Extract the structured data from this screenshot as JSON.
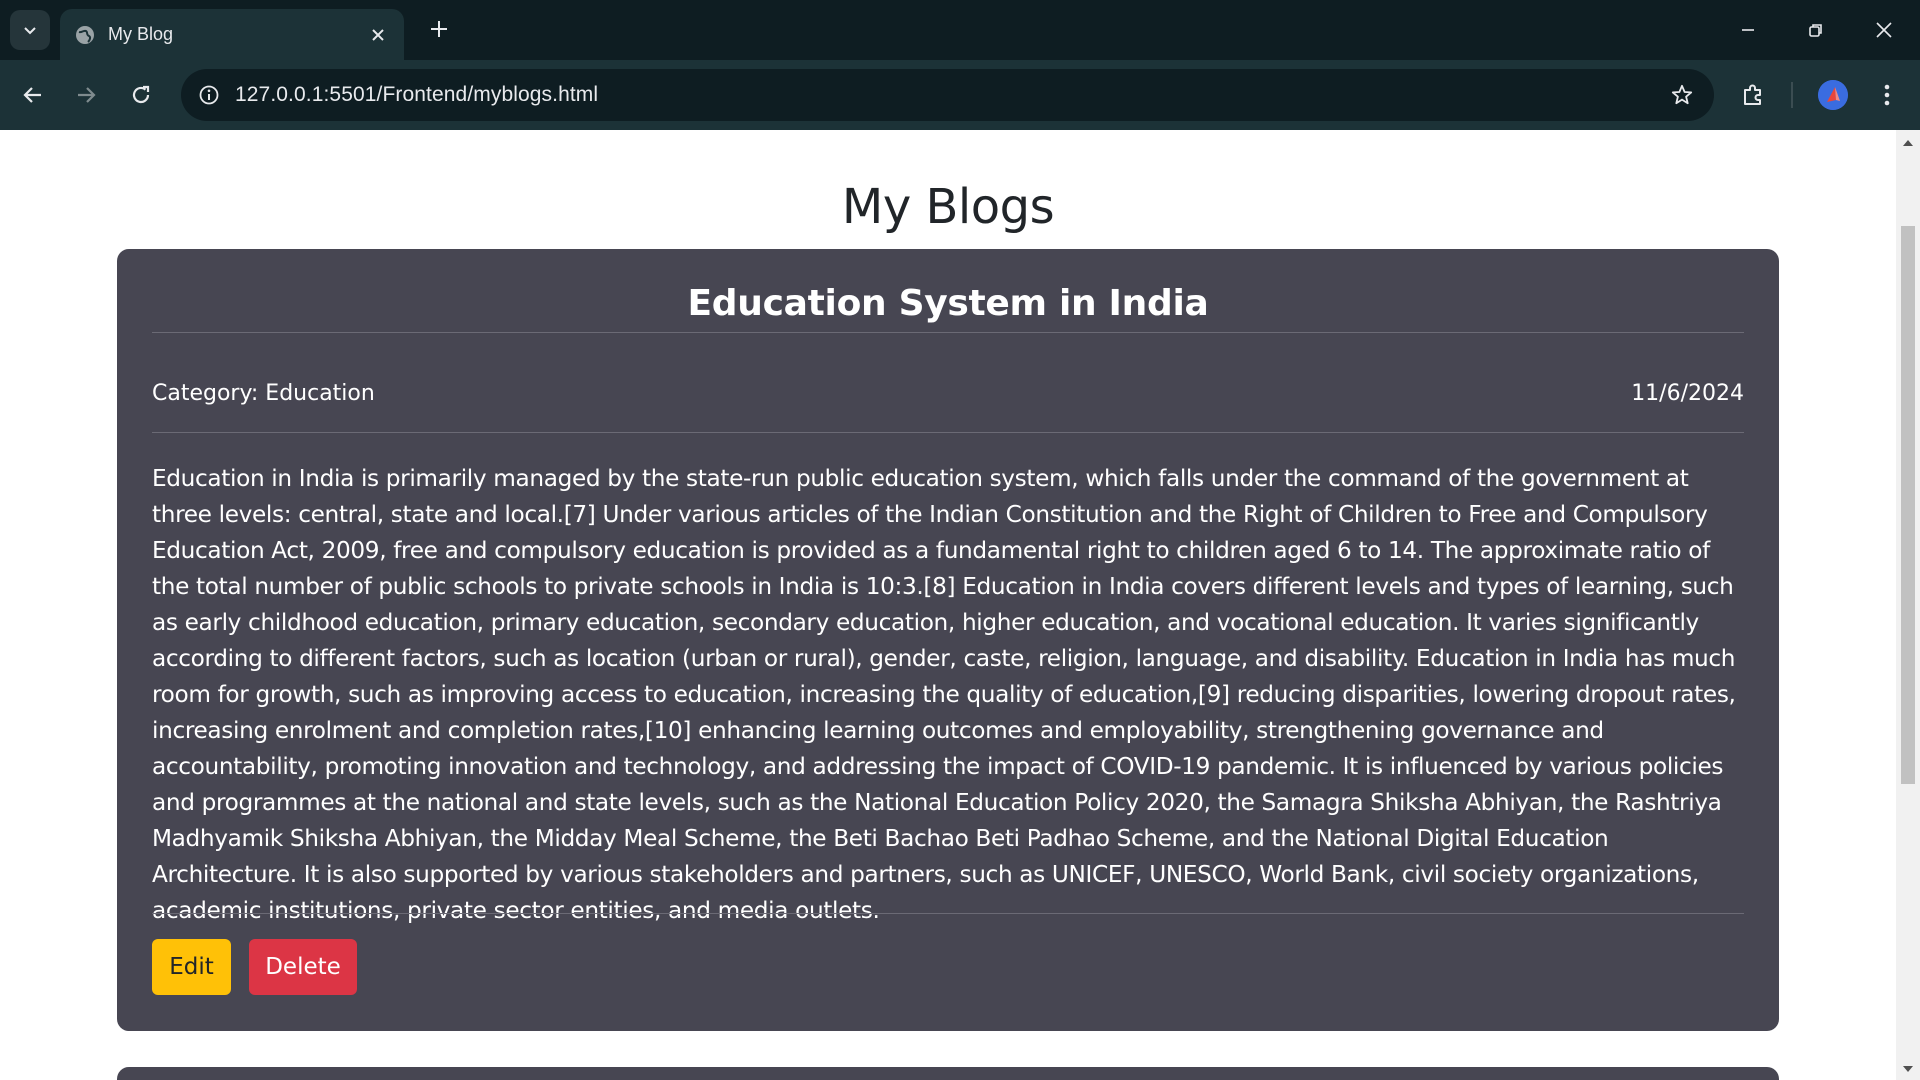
{
  "browser": {
    "tab_title": "My Blog",
    "url": "127.0.0.1:5501/Frontend/myblogs.html"
  },
  "page": {
    "heading": "My Blogs"
  },
  "blogs": [
    {
      "title": "Education System in India",
      "category": "Category: Education",
      "date": "11/6/2024",
      "content": "Education in India is primarily managed by the state-run public education system, which falls under the command of the government at three levels: central, state and local.[7] Under various articles of the Indian Constitution and the Right of Children to Free and Compulsory Education Act, 2009, free and compulsory education is provided as a fundamental right to children aged 6 to 14. The approximate ratio of the total number of public schools to private schools in India is 10:3.[8] Education in India covers different levels and types of learning, such as early childhood education, primary education, secondary education, higher education, and vocational education. It varies significantly according to different factors, such as location (urban or rural), gender, caste, religion, language, and disability. Education in India has much room for growth, such as improving access to education, increasing the quality of education,[9] reducing disparities, lowering dropout rates, increasing enrolment and completion rates,[10] enhancing learning outcomes and employability, strengthening governance and accountability, promoting innovation and technology, and addressing the impact of COVID-19 pandemic. It is influenced by various policies and programmes at the national and state levels, such as the National Education Policy 2020, the Samagra Shiksha Abhiyan, the Rashtriya Madhyamik Shiksha Abhiyan, the Midday Meal Scheme, the Beti Bachao Beti Padhao Scheme, and the National Digital Education Architecture. It is also supported by various stakeholders and partners, such as UNICEF, UNESCO, World Bank, civil society organizations, academic institutions, private sector entities, and media outlets.",
      "edit_label": "Edit",
      "delete_label": "Delete"
    }
  ],
  "colors": {
    "chrome_dark": "#0e1d22",
    "chrome_toolbar": "#1c3237",
    "card_bg": "#474652",
    "edit_button": "#ffc107",
    "delete_button": "#dc3545"
  },
  "icons": {
    "tab_search": "chevron-down-icon",
    "favicon": "globe-icon",
    "tab_close": "close-icon",
    "new_tab": "plus-icon",
    "minimize": "minimize-icon",
    "restore": "restore-icon",
    "close_window": "close-icon",
    "back": "arrow-left-icon",
    "forward": "arrow-right-icon",
    "reload": "reload-icon",
    "site_info": "info-icon",
    "bookmark": "star-icon",
    "extensions": "puzzle-icon",
    "menu": "kebab-menu-icon"
  }
}
